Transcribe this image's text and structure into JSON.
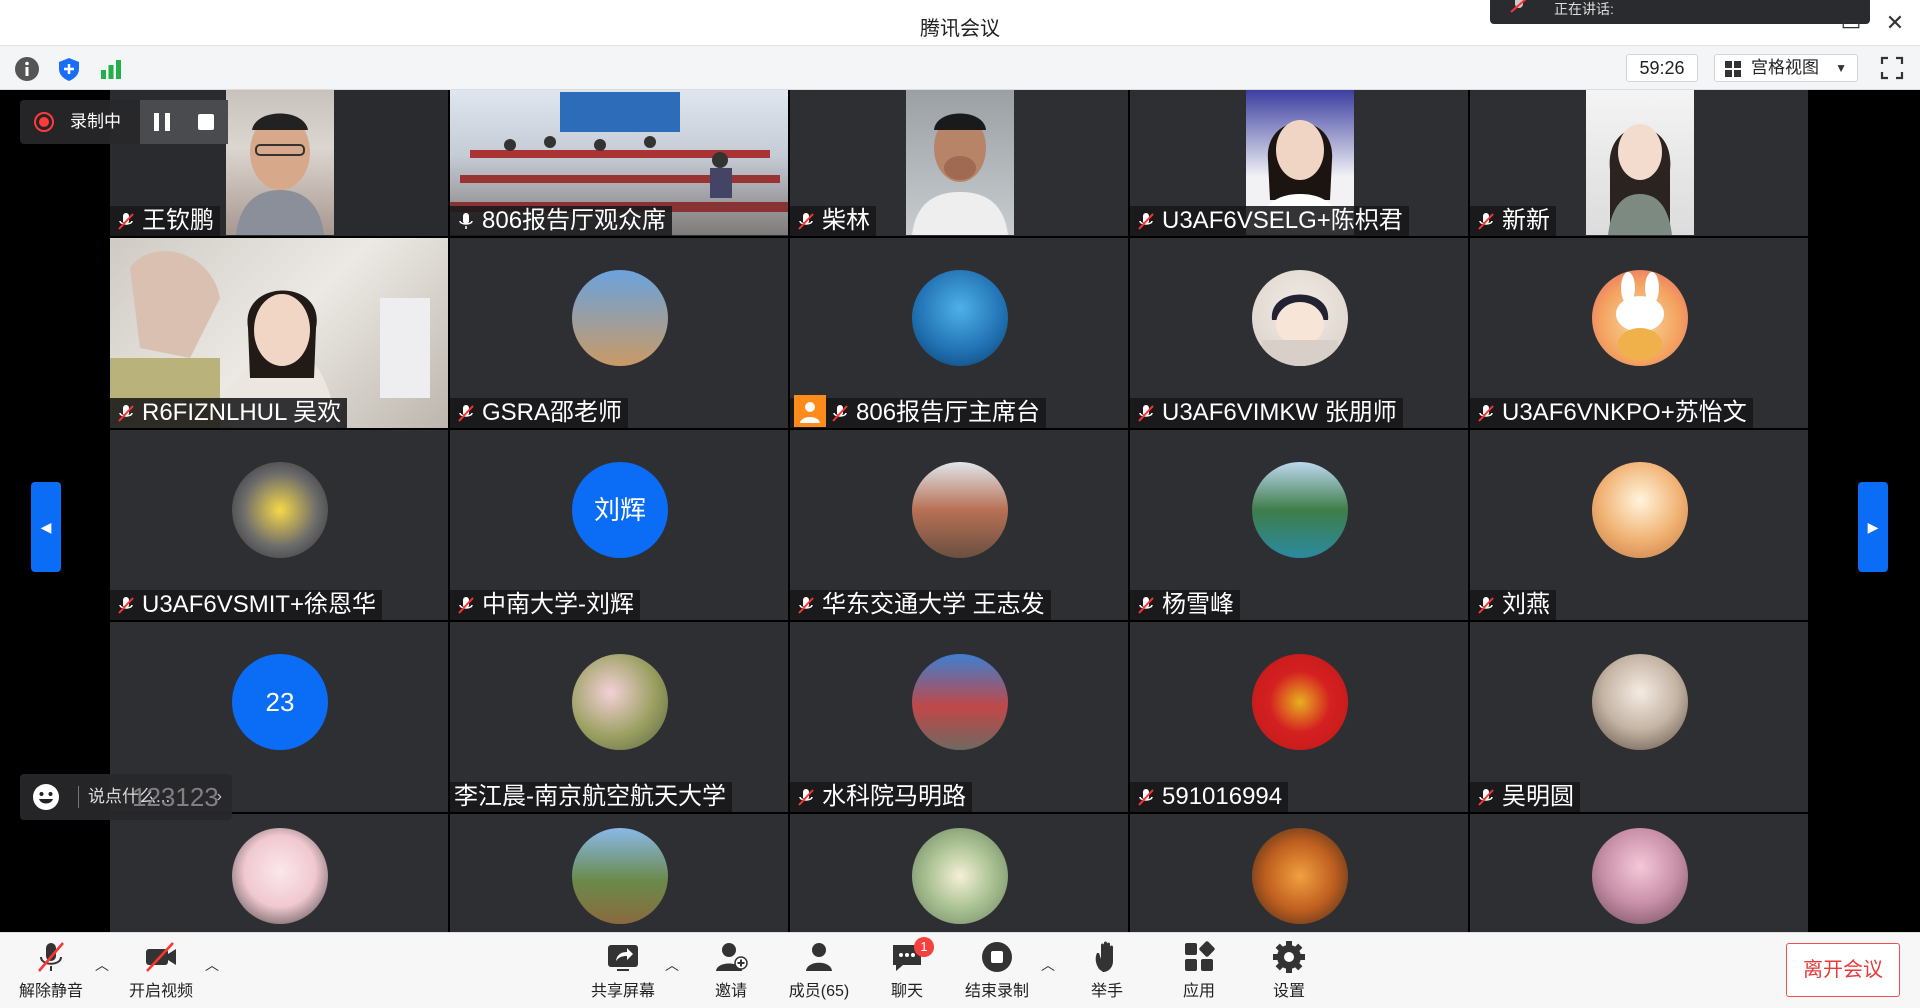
{
  "window": {
    "title": "腾讯会议",
    "speaking_text": "正在讲话:"
  },
  "infobar": {
    "timer": "59:26",
    "view_mode": "宫格视图"
  },
  "recording": {
    "label": "录制中"
  },
  "chat": {
    "placeholder": "说点什么...",
    "overlay_text": "123123"
  },
  "participants": [
    {
      "name": "王钦鹏",
      "kind": "video",
      "mic": "muted"
    },
    {
      "name": "806报告厅观众席",
      "kind": "video",
      "mic": "on"
    },
    {
      "name": "柴林",
      "kind": "video",
      "mic": "muted"
    },
    {
      "name": "U3AF6VSELG+陈枳君",
      "kind": "video",
      "mic": "muted"
    },
    {
      "name": "新新",
      "kind": "video",
      "mic": "muted"
    },
    {
      "name": "R6FIZNLHUL 吴欢",
      "kind": "video",
      "mic": "muted"
    },
    {
      "name": "GSRA邵老师",
      "kind": "avatar",
      "mic": "muted"
    },
    {
      "name": "806报告厅主席台",
      "kind": "avatar",
      "mic": "muted",
      "sharing": true
    },
    {
      "name": "U3AF6VIMKW 张朋师",
      "kind": "avatar",
      "mic": "muted"
    },
    {
      "name": "U3AF6VNKPO+苏怡文",
      "kind": "avatar",
      "mic": "muted"
    },
    {
      "name": "U3AF6VSMIT+徐恩华",
      "kind": "avatar",
      "mic": "muted"
    },
    {
      "name": "中南大学-刘辉",
      "kind": "text-avatar",
      "avatar_text": "刘辉",
      "mic": "muted"
    },
    {
      "name": "华东交通大学 王志发",
      "kind": "avatar",
      "mic": "muted"
    },
    {
      "name": "杨雪峰",
      "kind": "avatar",
      "mic": "muted"
    },
    {
      "name": "刘燕",
      "kind": "avatar",
      "mic": "muted"
    },
    {
      "name": "",
      "kind": "text-avatar",
      "avatar_text": "23",
      "mic": "none"
    },
    {
      "name": "李江晨-南京航空航天大学",
      "kind": "avatar",
      "mic": "none"
    },
    {
      "name": "水科院马明路",
      "kind": "avatar",
      "mic": "muted"
    },
    {
      "name": "591016994",
      "kind": "avatar",
      "mic": "muted"
    },
    {
      "name": "吴明圆",
      "kind": "avatar",
      "mic": "muted"
    },
    {
      "name": "",
      "kind": "avatar",
      "mic": "none"
    },
    {
      "name": "",
      "kind": "avatar",
      "mic": "none"
    },
    {
      "name": "",
      "kind": "avatar",
      "mic": "none"
    },
    {
      "name": "",
      "kind": "avatar",
      "mic": "none"
    },
    {
      "name": "",
      "kind": "avatar",
      "mic": "none"
    }
  ],
  "toolbar": {
    "unmute": "解除静音",
    "start_video": "开启视频",
    "share_screen": "共享屏幕",
    "invite": "邀请",
    "members": "成员(65)",
    "chat": "聊天",
    "chat_badge": "1",
    "end_record": "结束录制",
    "raise_hand": "举手",
    "apps": "应用",
    "settings": "设置",
    "leave": "离开会议"
  },
  "colors": {
    "accent": "#0b6cf6",
    "record_red": "#ff3a3a",
    "leave_red": "#e73a3a",
    "share_orange": "#ff8c1a"
  }
}
